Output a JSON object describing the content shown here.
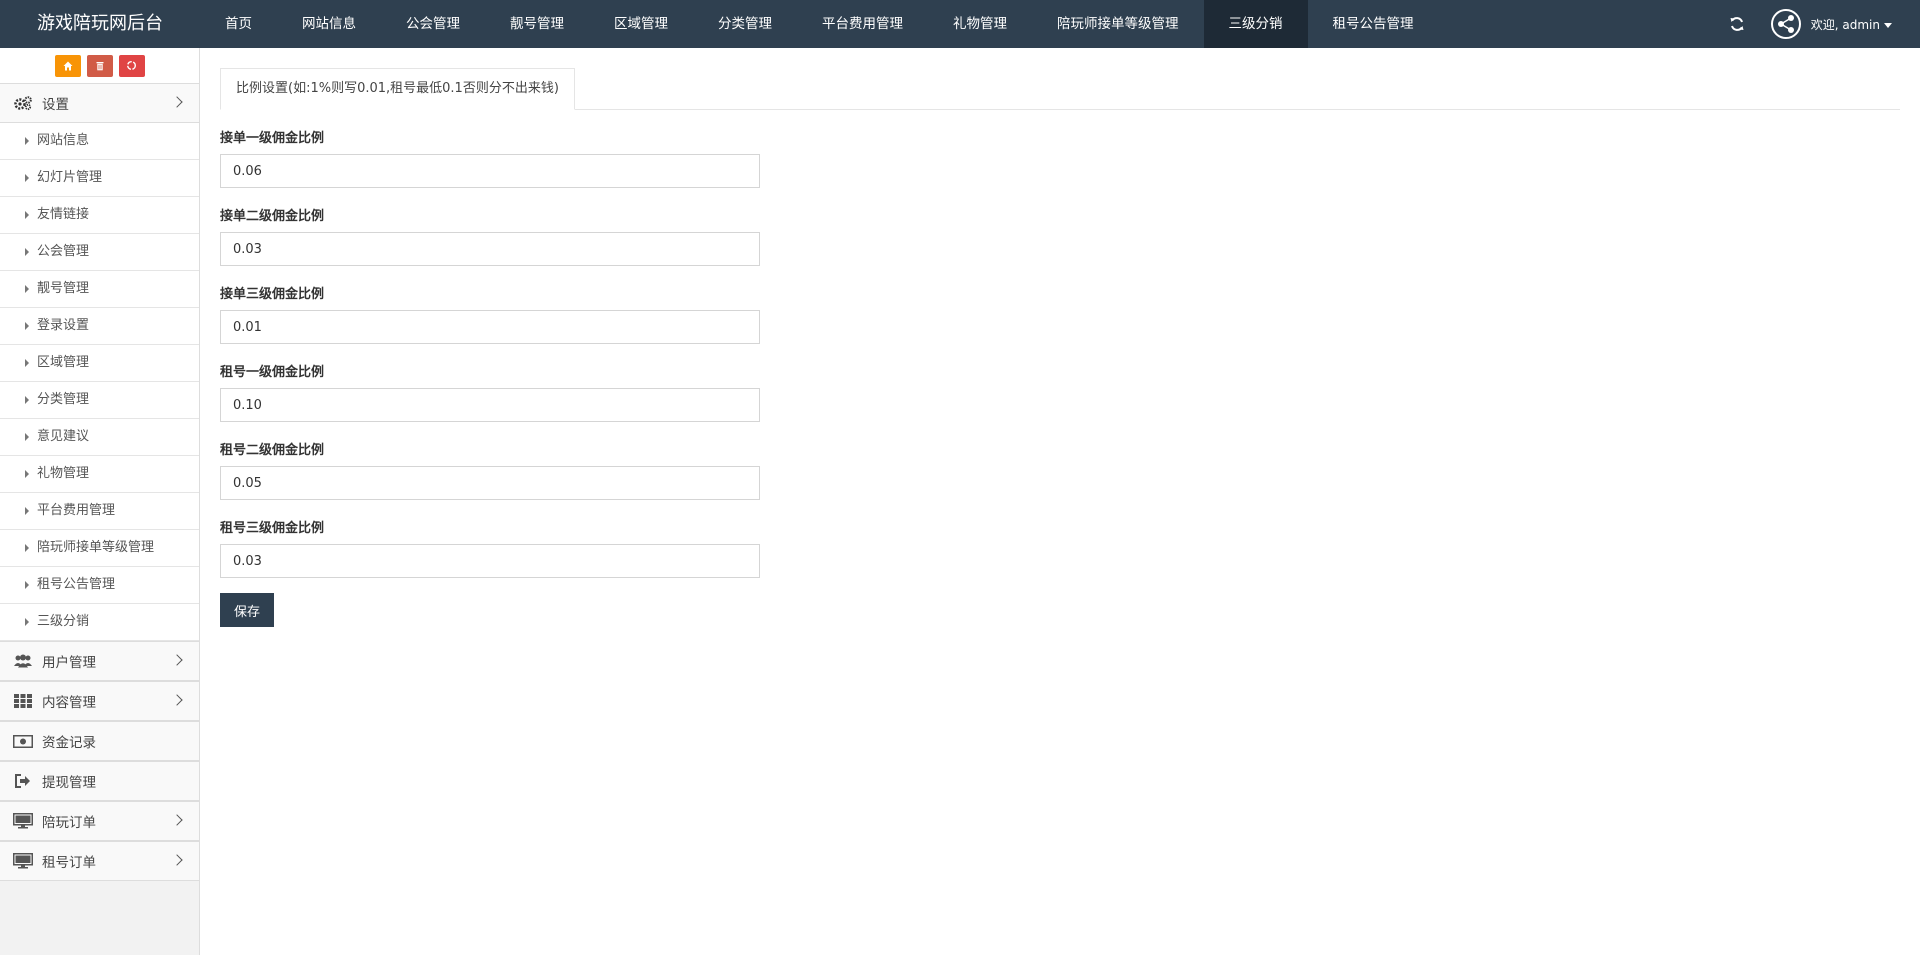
{
  "app": {
    "title": "游戏陪玩网后台"
  },
  "topnav": {
    "items": [
      {
        "label": "首页"
      },
      {
        "label": "网站信息"
      },
      {
        "label": "公会管理"
      },
      {
        "label": "靓号管理"
      },
      {
        "label": "区域管理"
      },
      {
        "label": "分类管理"
      },
      {
        "label": "平台费用管理"
      },
      {
        "label": "礼物管理"
      },
      {
        "label": "陪玩师接单等级管理"
      },
      {
        "label": "三级分销"
      },
      {
        "label": "租号公告管理"
      }
    ],
    "active": "三级分销",
    "welcome": "欢迎, admin"
  },
  "sidebar": {
    "shortcut_icons": [
      "home-icon",
      "trash-icon",
      "recycle-icon"
    ],
    "settings": {
      "label": "设置",
      "items": [
        {
          "label": "网站信息"
        },
        {
          "label": "幻灯片管理"
        },
        {
          "label": "友情链接"
        },
        {
          "label": "公会管理"
        },
        {
          "label": "靓号管理"
        },
        {
          "label": "登录设置"
        },
        {
          "label": "区域管理"
        },
        {
          "label": "分类管理"
        },
        {
          "label": "意见建议"
        },
        {
          "label": "礼物管理"
        },
        {
          "label": "平台费用管理"
        },
        {
          "label": "陪玩师接单等级管理"
        },
        {
          "label": "租号公告管理"
        },
        {
          "label": "三级分销"
        }
      ]
    },
    "menus": [
      {
        "label": "用户管理",
        "icon": "users-icon",
        "has_children": true
      },
      {
        "label": "内容管理",
        "icon": "grid-icon",
        "has_children": true
      },
      {
        "label": "资金记录",
        "icon": "money-icon",
        "has_children": false
      },
      {
        "label": "提现管理",
        "icon": "sign-out-icon",
        "has_children": false
      },
      {
        "label": "陪玩订单",
        "icon": "monitor-icon",
        "has_children": true
      },
      {
        "label": "租号订单",
        "icon": "monitor-icon",
        "has_children": true
      }
    ]
  },
  "main": {
    "tab_label": "比例设置(如:1%则写0.01,租号最低0.1否则分不出来钱)",
    "fields": [
      {
        "label": "接单一级佣金比例",
        "value": "0.06"
      },
      {
        "label": "接单二级佣金比例",
        "value": "0.03"
      },
      {
        "label": "接单三级佣金比例",
        "value": "0.01"
      },
      {
        "label": "租号一级佣金比例",
        "value": "0.10"
      },
      {
        "label": "租号二级佣金比例",
        "value": "0.05"
      },
      {
        "label": "租号三级佣金比例",
        "value": "0.03"
      }
    ],
    "save_label": "保存"
  },
  "colors": {
    "navbar": "#2f4050",
    "nav_active": "#1e2a36",
    "shortcut_orange": "#f89406",
    "shortcut_red": "#d15b47",
    "save_button": "#2f4050"
  }
}
